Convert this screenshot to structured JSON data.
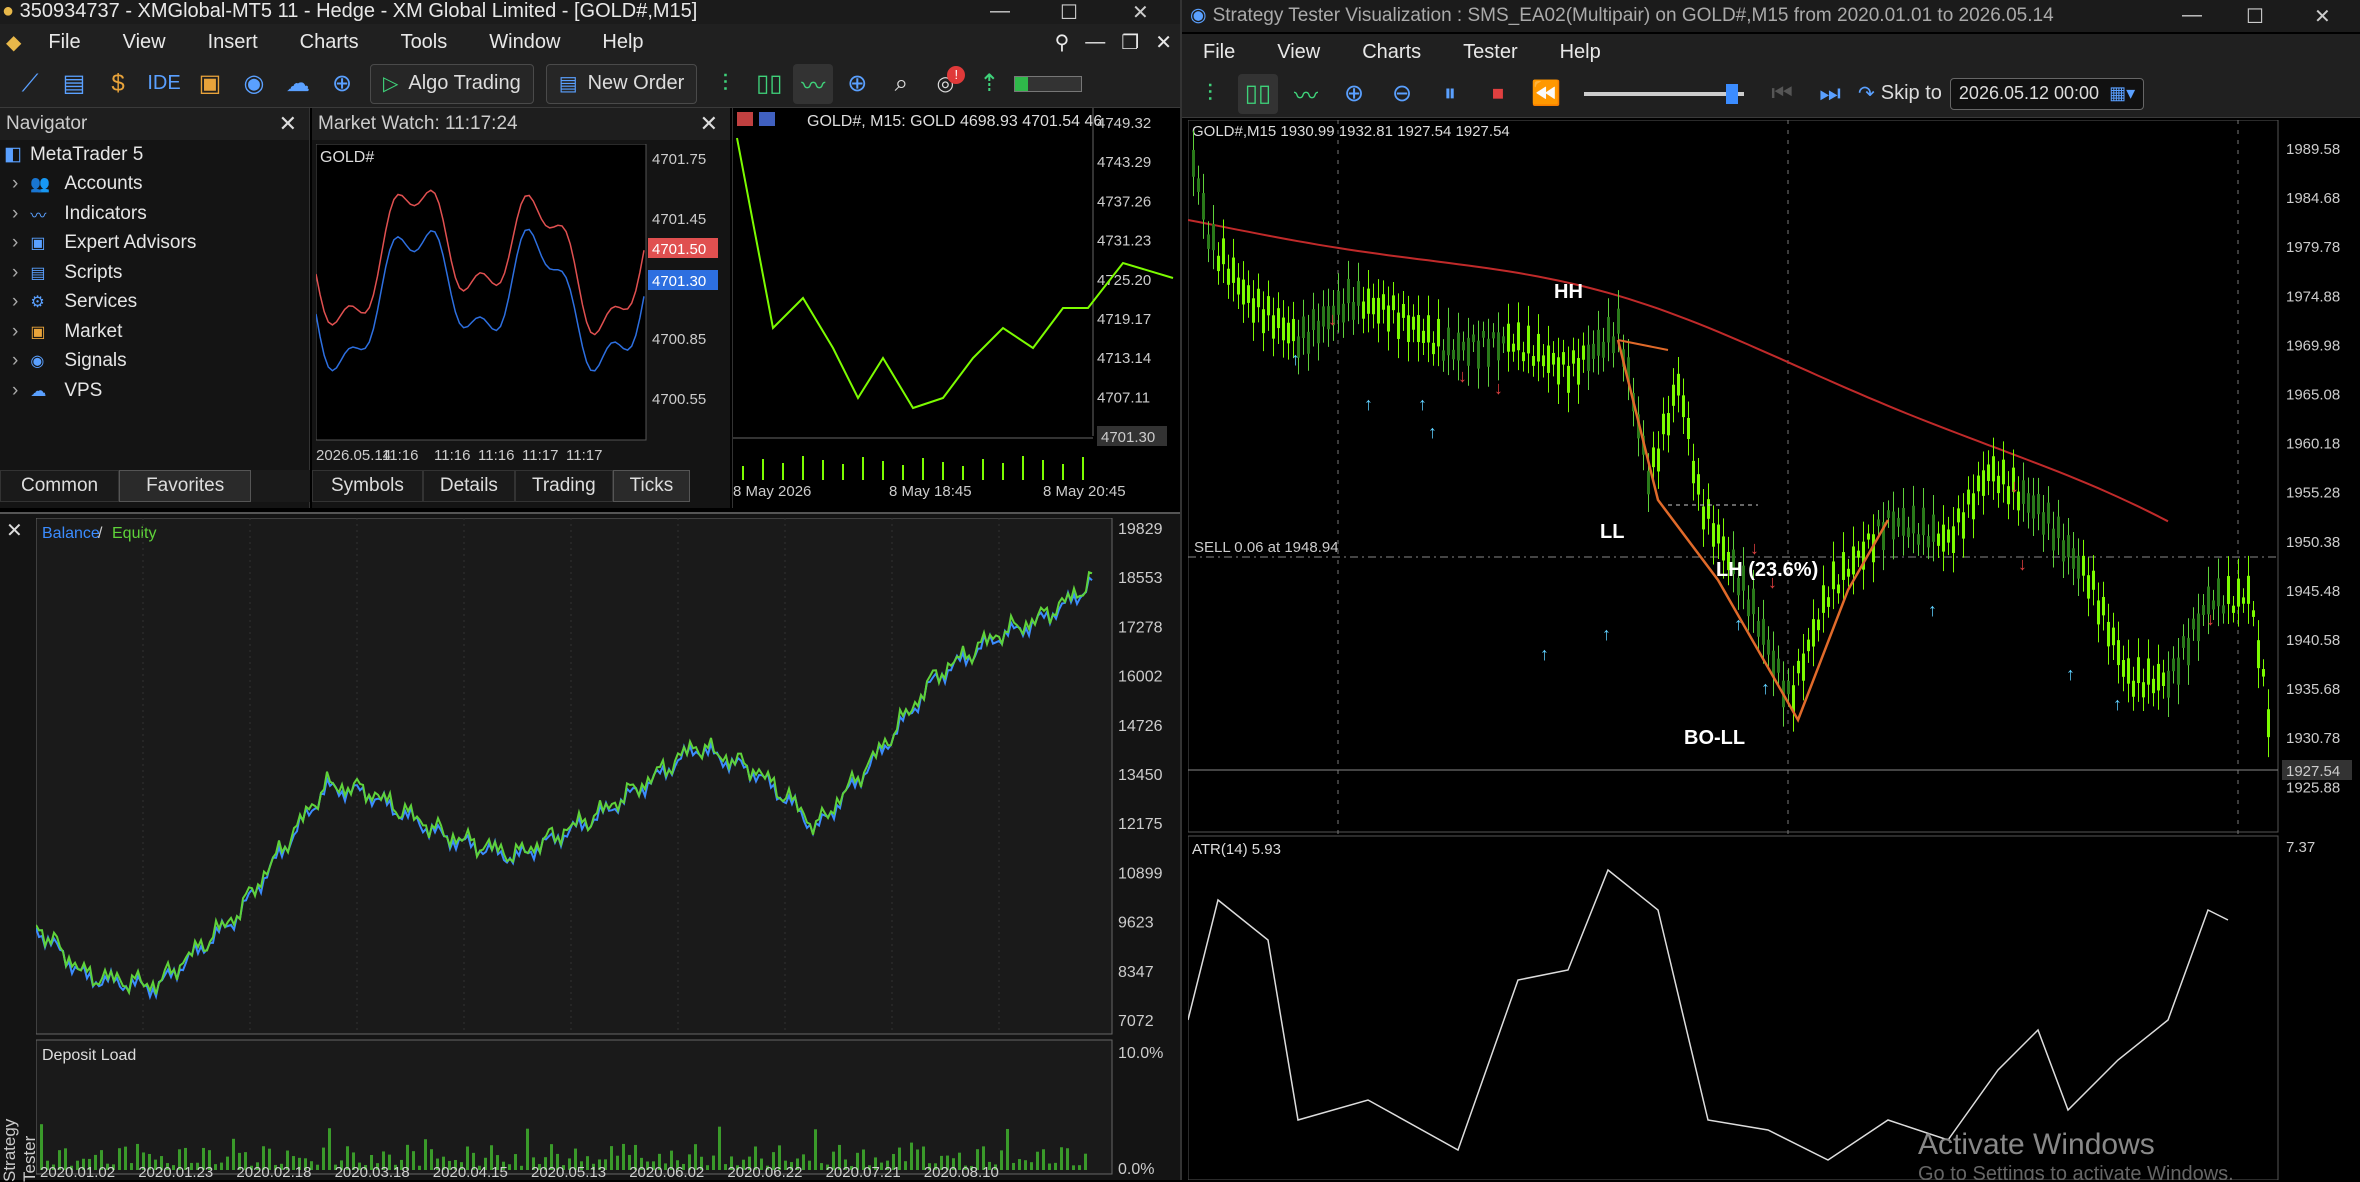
{
  "main": {
    "title": "350934737 - XMGlobal-MT5 11 - Hedge - XM Global Limited - [GOLD#,M15]",
    "menu": [
      "File",
      "View",
      "Insert",
      "Charts",
      "Tools",
      "Window",
      "Help"
    ],
    "toolbar": {
      "ide": "IDE",
      "algo": "Algo Trading",
      "new_order": "New Order",
      "notif_badge": "!"
    }
  },
  "navigator": {
    "title": "Navigator",
    "root": "MetaTrader 5",
    "items": [
      {
        "label": "Accounts",
        "icon": "accounts-icon"
      },
      {
        "label": "Indicators",
        "icon": "indicators-icon"
      },
      {
        "label": "Expert Advisors",
        "icon": "expert-advisors-icon"
      },
      {
        "label": "Scripts",
        "icon": "scripts-icon"
      },
      {
        "label": "Services",
        "icon": "services-icon"
      },
      {
        "label": "Market",
        "icon": "market-icon"
      },
      {
        "label": "Signals",
        "icon": "signals-icon"
      },
      {
        "label": "VPS",
        "icon": "vps-icon"
      }
    ],
    "tabs": [
      "Common",
      "Favorites"
    ]
  },
  "market_watch": {
    "title": "Market Watch: 11:17:24",
    "symbol": "GOLD#",
    "y_ticks": [
      "4701.75",
      "4701.45",
      "4701.15",
      "4700.85",
      "4700.55"
    ],
    "ask_tag": "4701.50",
    "bid_tag": "4701.30",
    "x_ticks": [
      "2026.05.14",
      "11:16",
      "11:16",
      "11:16",
      "11:17",
      "11:17"
    ],
    "tabs": [
      "Symbols",
      "Details",
      "Trading",
      "Ticks"
    ]
  },
  "mini_chart": {
    "header": "GOLD#, M15:  GOLD  4698.93 4701.54 46",
    "y_ticks": [
      "4749.32",
      "4743.29",
      "4737.26",
      "4731.23",
      "4725.20",
      "4719.17",
      "4713.14",
      "4707.11"
    ],
    "price_tag": "4701.30",
    "x_ticks": [
      "8 May 2026",
      "8 May 18:45",
      "8 May 20:45"
    ]
  },
  "tester_graph": {
    "legend_balance": "Balance",
    "legend_sep": " / ",
    "legend_equity": "Equity",
    "y_ticks": [
      "19829",
      "18553",
      "17278",
      "16002",
      "14726",
      "13450",
      "12175",
      "10899",
      "9623",
      "8347",
      "7072"
    ],
    "deposit_label": "Deposit Load",
    "deposit_ticks": [
      "10.0%",
      "0.0%"
    ],
    "x_ticks": [
      "2020.01.02",
      "2020.01.23",
      "2020.02.18",
      "2020.03.18",
      "2020.04.15",
      "2020.05.13",
      "2020.06.02",
      "2020.06.22",
      "2020.07.21",
      "2020.08.10"
    ],
    "side_label": "Strategy Tester"
  },
  "visual": {
    "title": "Strategy Tester Visualization : SMS_EA02(Multipair) on GOLD#,M15 from 2020.01.01 to 2026.05.14",
    "menu": [
      "File",
      "View",
      "Charts",
      "Tester",
      "Help"
    ],
    "skip_label": "Skip to",
    "skip_value": "2026.05.12 00:00",
    "chart_header": "GOLD#,M15  1930.99 1932.81 1927.54 1927.54",
    "y_ticks": [
      "1989.58",
      "1984.68",
      "1979.78",
      "1974.88",
      "1969.98",
      "1965.08",
      "1960.18",
      "1955.28",
      "1950.38",
      "1945.48",
      "1940.58",
      "1935.68",
      "1930.78",
      "1925.88"
    ],
    "price_tag": "1927.54",
    "sell_label": "SELL 0.06 at 1948.94",
    "annotations": {
      "hh": "HH",
      "ll": "LL",
      "lh": "LH (23.6%)",
      "boll": "BO-LL"
    },
    "atr_label": "ATR(14) 5.93",
    "atr_tick": "7.37",
    "watermark": "Activate Windows",
    "watermark_sub": "Go to Settings to activate Windows."
  },
  "colors": {
    "balance": "#3b8cff",
    "equity": "#5fd23a",
    "bull": "#7cfc00",
    "ask": "#e05050",
    "bid": "#2d6fe0",
    "ma": "#c02a2a"
  }
}
